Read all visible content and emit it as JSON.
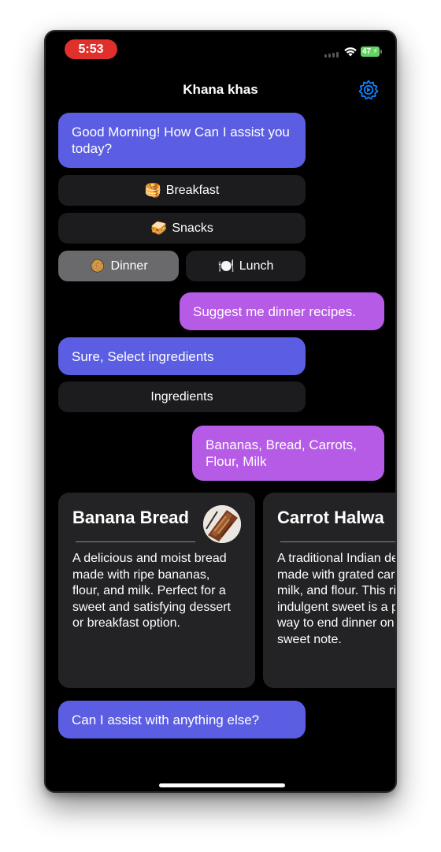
{
  "status_bar": {
    "time": "5:53",
    "battery": "47"
  },
  "header": {
    "title": "Khana khas",
    "settings_icon": "gear-icon"
  },
  "messages": {
    "greeting": "Good Morning! How Can I assist you today?",
    "user_request": "Suggest me dinner recipes.",
    "select_prompt": "Sure, Select ingredients",
    "user_ingredients": "Bananas, Bread, Carrots, Flour, Milk",
    "closing": "Can I assist with anything else?"
  },
  "options": {
    "breakfast": {
      "emoji": "🥞",
      "label": "Breakfast"
    },
    "snacks": {
      "emoji": "🥪",
      "label": "Snacks"
    },
    "dinner": {
      "emoji": "🥘",
      "label": "Dinner",
      "selected": true
    },
    "lunch": {
      "emoji": "🍽️",
      "label": "Lunch"
    },
    "ingredients": {
      "label": "Ingredients"
    }
  },
  "recipes": [
    {
      "title": "Banana Bread",
      "description": "A delicious and moist bread made with ripe bananas, flour, and milk. Perfect for a sweet and satisfying dessert or breakfast option."
    },
    {
      "title": "Carrot Halwa",
      "description": "A traditional Indian dessert made with grated carrots, milk, and flour. This rich and indulgent sweet is a perfect way to end dinner on a sweet note."
    }
  ],
  "colors": {
    "bot_bubble": "#5b5ee2",
    "user_bubble": "#b65be6",
    "option_bg": "#1c1c1e",
    "option_active_bg": "#6a6a6c",
    "card_bg": "#232325",
    "time_pill": "#e0302b",
    "accent": "#0a84ff"
  }
}
